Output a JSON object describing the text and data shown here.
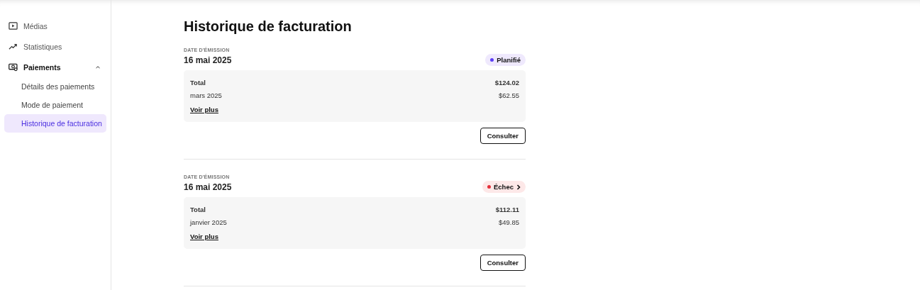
{
  "sidebar": {
    "items": [
      {
        "label": "Médias",
        "kind": "play",
        "selected": false
      },
      {
        "label": "Statistiques",
        "kind": "trend",
        "selected": false
      },
      {
        "label": "Paiements",
        "kind": "money",
        "selected": false,
        "expanded": true,
        "children": [
          {
            "label": "Détails des paiements",
            "selected": false
          },
          {
            "label": "Mode de paiement",
            "selected": false
          },
          {
            "label": "Historique de facturation",
            "selected": true
          }
        ]
      }
    ]
  },
  "page": {
    "title": "Historique de facturation"
  },
  "invoices": [
    {
      "date_label": "DATE D'ÉMISSION",
      "date": "16 mai 2025",
      "status": {
        "label": "Planifié",
        "kind": "scheduled",
        "color": "#5b3df5"
      },
      "total_label": "Total",
      "total": "$124.02",
      "line_label": "mars 2025",
      "line_amount": "$62.55",
      "more": "Voir plus",
      "action": "Consulter"
    },
    {
      "date_label": "DATE D'ÉMISSION",
      "date": "16 mai 2025",
      "status": {
        "label": "Échec",
        "kind": "failed",
        "color": "#e5303a"
      },
      "total_label": "Total",
      "total": "$112.11",
      "line_label": "janvier 2025",
      "line_amount": "$49.85",
      "more": "Voir plus",
      "action": "Consulter"
    }
  ]
}
